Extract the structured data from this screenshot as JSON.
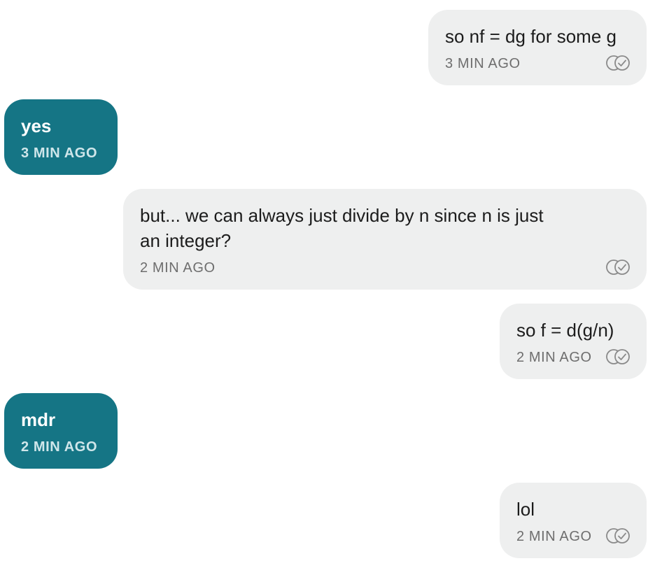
{
  "messages": [
    {
      "direction": "outgoing",
      "text": "so nf = dg for some g",
      "time": "3 MIN AGO",
      "receipt_icon": "double-check-circle-icon"
    },
    {
      "direction": "incoming",
      "text": "yes",
      "time": "3 MIN AGO"
    },
    {
      "direction": "outgoing",
      "text": "but... we can always just divide by n since n is just\nan integer?",
      "time": "2 MIN AGO",
      "receipt_icon": "double-check-circle-icon"
    },
    {
      "direction": "outgoing",
      "text": "so f = d(g/n)",
      "time": "2 MIN AGO",
      "receipt_icon": "double-check-circle-icon"
    },
    {
      "direction": "incoming",
      "text": "mdr",
      "time": "2 MIN AGO"
    },
    {
      "direction": "outgoing",
      "text": "lol",
      "time": "2 MIN AGO",
      "receipt_icon": "double-check-circle-icon"
    }
  ],
  "colors": {
    "outgoing_bubble": "#eeefef",
    "incoming_bubble": "#157585",
    "outgoing_text": "#1c1c1c",
    "incoming_text": "#ffffff",
    "timestamp_outgoing": "#6e6e6e",
    "timestamp_incoming": "#cfe6ea",
    "receipt_icon": "#8a8a8a"
  }
}
